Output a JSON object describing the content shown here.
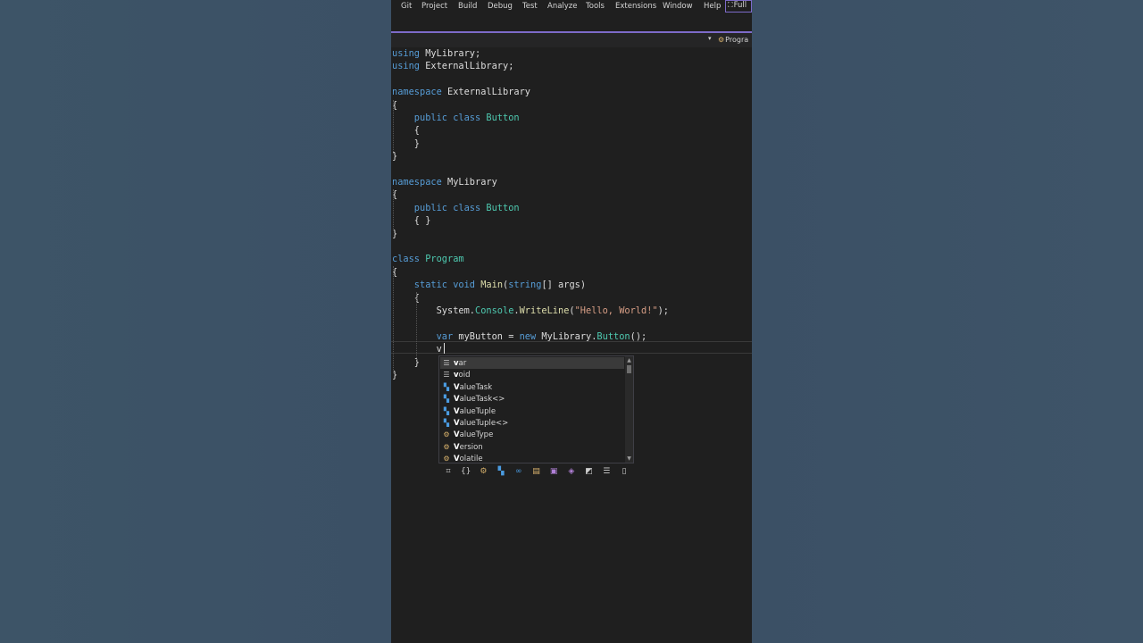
{
  "menu": {
    "items": [
      "Git",
      "Project",
      "Build",
      "Debug",
      "Test",
      "Analyze",
      "Tools",
      "Extensions",
      "Window",
      "Help"
    ],
    "full_label": "Full"
  },
  "navbar": {
    "scope_label": "Progra"
  },
  "code": {
    "lines": [
      [
        {
          "t": "using",
          "c": "kw"
        },
        {
          "t": " MyLibrary;",
          "c": "id"
        }
      ],
      [
        {
          "t": "using",
          "c": "kw"
        },
        {
          "t": " ExternalLibrary;",
          "c": "id"
        }
      ],
      [],
      [
        {
          "t": "namespace",
          "c": "kw"
        },
        {
          "t": " ExternalLibrary",
          "c": "id"
        }
      ],
      [
        {
          "t": "{",
          "c": "id"
        }
      ],
      [
        {
          "t": "    public",
          "c": "kw"
        },
        {
          "t": " ",
          "c": "id"
        },
        {
          "t": "class",
          "c": "kw"
        },
        {
          "t": " ",
          "c": "id"
        },
        {
          "t": "Button",
          "c": "ty"
        }
      ],
      [
        {
          "t": "    {",
          "c": "id"
        }
      ],
      [
        {
          "t": "    }",
          "c": "id"
        }
      ],
      [
        {
          "t": "}",
          "c": "id"
        }
      ],
      [],
      [
        {
          "t": "namespace",
          "c": "kw"
        },
        {
          "t": " MyLibrary",
          "c": "id"
        }
      ],
      [
        {
          "t": "{",
          "c": "id"
        }
      ],
      [
        {
          "t": "    public",
          "c": "kw"
        },
        {
          "t": " ",
          "c": "id"
        },
        {
          "t": "class",
          "c": "kw"
        },
        {
          "t": " ",
          "c": "id"
        },
        {
          "t": "Button",
          "c": "ty"
        }
      ],
      [
        {
          "t": "    { }",
          "c": "id"
        }
      ],
      [
        {
          "t": "}",
          "c": "id"
        }
      ],
      [],
      [
        {
          "t": "class",
          "c": "kw"
        },
        {
          "t": " ",
          "c": "id"
        },
        {
          "t": "Program",
          "c": "ty"
        }
      ],
      [
        {
          "t": "{",
          "c": "id"
        }
      ],
      [
        {
          "t": "    static",
          "c": "kw"
        },
        {
          "t": " ",
          "c": "id"
        },
        {
          "t": "void",
          "c": "kw"
        },
        {
          "t": " ",
          "c": "id"
        },
        {
          "t": "Main",
          "c": "fn"
        },
        {
          "t": "(",
          "c": "id"
        },
        {
          "t": "string",
          "c": "kw"
        },
        {
          "t": "[] ",
          "c": "id"
        },
        {
          "t": "args",
          "c": "id"
        },
        {
          "t": ")",
          "c": "id"
        }
      ],
      [
        {
          "t": "    {",
          "c": "id"
        }
      ],
      [
        {
          "t": "        System.",
          "c": "id"
        },
        {
          "t": "Console",
          "c": "ty"
        },
        {
          "t": ".",
          "c": "id"
        },
        {
          "t": "WriteLine",
          "c": "fn"
        },
        {
          "t": "(",
          "c": "id"
        },
        {
          "t": "\"Hello, World!\"",
          "c": "str"
        },
        {
          "t": ");",
          "c": "id"
        }
      ],
      [],
      [
        {
          "t": "        var",
          "c": "kw"
        },
        {
          "t": " myButton = ",
          "c": "id"
        },
        {
          "t": "new",
          "c": "kw"
        },
        {
          "t": " MyLibrary.",
          "c": "id"
        },
        {
          "t": "Button",
          "c": "ty"
        },
        {
          "t": "();",
          "c": "id"
        }
      ],
      [
        {
          "t": "        v",
          "c": "id"
        }
      ],
      [
        {
          "t": "    }",
          "c": "id"
        }
      ],
      [
        {
          "t": "}",
          "c": "id"
        }
      ]
    ]
  },
  "completion": {
    "typed": "v",
    "items": [
      {
        "label": "var",
        "icon": "keyword-icon",
        "glyph": "☰",
        "cls": "kwi",
        "selected": true
      },
      {
        "label": "void",
        "icon": "keyword-icon",
        "glyph": "☰",
        "cls": "kwi",
        "selected": false
      },
      {
        "label": "ValueTask",
        "icon": "struct-icon",
        "glyph": "▚",
        "cls": "str-i",
        "selected": false
      },
      {
        "label": "ValueTask<>",
        "icon": "struct-icon",
        "glyph": "▚",
        "cls": "str-i",
        "selected": false
      },
      {
        "label": "ValueTuple",
        "icon": "struct-icon",
        "glyph": "▚",
        "cls": "str-i",
        "selected": false
      },
      {
        "label": "ValueTuple<>",
        "icon": "struct-icon",
        "glyph": "▚",
        "cls": "str-i",
        "selected": false
      },
      {
        "label": "ValueType",
        "icon": "class-icon",
        "glyph": "⚙",
        "cls": "cls-i",
        "selected": false
      },
      {
        "label": "Version",
        "icon": "class-icon",
        "glyph": "⚙",
        "cls": "cls-i",
        "selected": false
      },
      {
        "label": "Volatile",
        "icon": "class-icon",
        "glyph": "⚙",
        "cls": "cls-i",
        "selected": false
      }
    ],
    "filters": [
      {
        "name": "filter-locals-icon",
        "glyph": "⌗",
        "color": "#cfcfcf"
      },
      {
        "name": "filter-namespace-icon",
        "glyph": "{}",
        "color": "#cfcfcf"
      },
      {
        "name": "filter-class-icon",
        "glyph": "⚙",
        "color": "#d8b26c"
      },
      {
        "name": "filter-struct-icon",
        "glyph": "▚",
        "color": "#4a9be0"
      },
      {
        "name": "filter-interface-icon",
        "glyph": "∞",
        "color": "#4a9be0"
      },
      {
        "name": "filter-enum-icon",
        "glyph": "▤",
        "color": "#d8b26c"
      },
      {
        "name": "filter-delegate-icon",
        "glyph": "▣",
        "color": "#b180d7"
      },
      {
        "name": "filter-extension-icon",
        "glyph": "◈",
        "color": "#b180d7"
      },
      {
        "name": "filter-snippet-icon",
        "glyph": "◩",
        "color": "#cfcfcf"
      },
      {
        "name": "filter-keyword-icon",
        "glyph": "☰",
        "color": "#cfcfcf"
      },
      {
        "name": "filter-target-typed-icon",
        "glyph": "▯",
        "color": "#cfcfcf"
      }
    ]
  },
  "colors": {
    "accent": "#7d6bc9",
    "editor_bg": "#1f1f1f",
    "keyword": "#569cd6",
    "type": "#4ec9b0",
    "method": "#dcdcaa",
    "string": "#d69d85"
  }
}
